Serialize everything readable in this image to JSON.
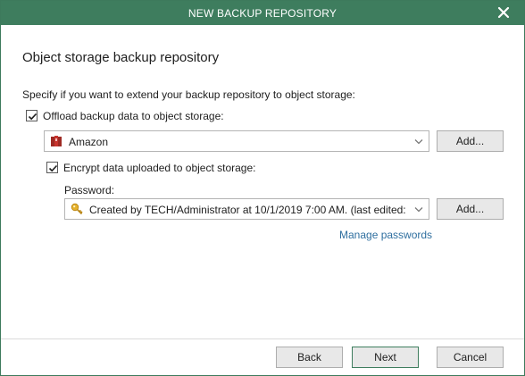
{
  "window": {
    "title": "NEW BACKUP REPOSITORY",
    "close_icon": "close-icon"
  },
  "page": {
    "heading": "Object storage backup repository",
    "instruction": "Specify if you want to extend your backup repository to object storage:"
  },
  "offload": {
    "label": "Offload backup data to object storage:",
    "checked": true
  },
  "storage_select": {
    "value": "Amazon",
    "icon": "amazon-icon"
  },
  "storage_add_label": "Add...",
  "encrypt": {
    "label": "Encrypt data uploaded to object storage:",
    "checked": true
  },
  "password": {
    "label": "Password:",
    "value": "Created by TECH/Administrator at 10/1/2019 7:00 AM. (last edited:",
    "icon": "key-icon"
  },
  "password_add_label": "Add...",
  "manage_passwords_label": "Manage passwords",
  "footer": {
    "back_label": "Back",
    "next_label": "Next",
    "cancel_label": "Cancel"
  },
  "colors": {
    "titlebar": "#3e7d5e",
    "link": "#2f6f9f",
    "amazon_red": "#c7332d",
    "key_yellow": "#e5b12c"
  }
}
